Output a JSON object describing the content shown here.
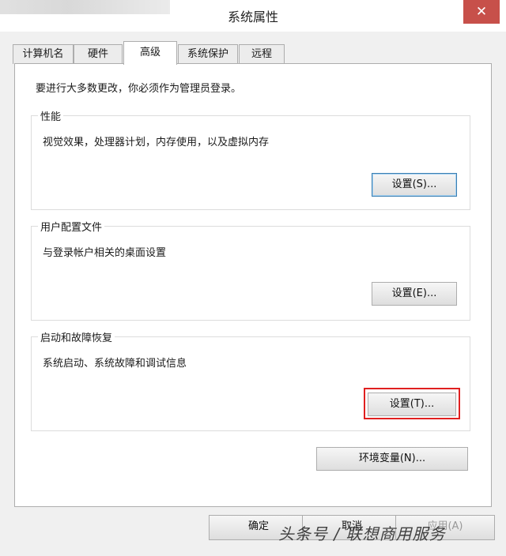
{
  "window": {
    "title": "系统属性",
    "close_label": "✕"
  },
  "tabs": [
    {
      "label": "计算机名"
    },
    {
      "label": "硬件"
    },
    {
      "label": "高级"
    },
    {
      "label": "系统保护"
    },
    {
      "label": "远程"
    }
  ],
  "active_tab": "高级",
  "notice": "要进行大多数更改，你必须作为管理员登录。",
  "groups": {
    "performance": {
      "title": "性能",
      "desc": "视觉效果，处理器计划，内存使用，以及虚拟内存",
      "button": "设置(S)..."
    },
    "user_profiles": {
      "title": "用户配置文件",
      "desc": "与登录帐户相关的桌面设置",
      "button": "设置(E)..."
    },
    "startup_recovery": {
      "title": "启动和故障恢复",
      "desc": "系统启动、系统故障和调试信息",
      "button": "设置(T)..."
    }
  },
  "env_button": "环境变量(N)...",
  "footer": {
    "ok": "确定",
    "cancel": "取消",
    "apply": "应用(A)"
  },
  "watermark": "头条号 / 联想商用服务",
  "colors": {
    "highlight": "#e02020",
    "close_button": "#c7504a"
  }
}
